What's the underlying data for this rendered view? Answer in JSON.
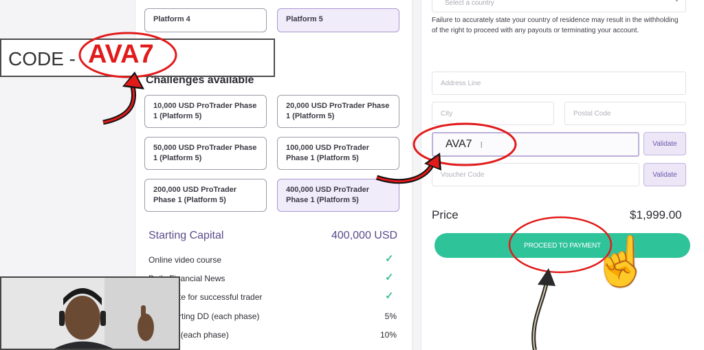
{
  "platforms": {
    "p4": "Platform 4",
    "p5": "Platform 5"
  },
  "promo": {
    "label": "CODE - ",
    "code": "AVA7"
  },
  "challenges": {
    "heading": "Challenges available",
    "items": [
      "10,000 USD ProTrader Phase 1 (Platform 5)",
      "20,000 USD ProTrader Phase 1 (Platform 5)",
      "50,000 USD ProTrader Phase 1 (Platform 5)",
      "100,000 USD ProTrader Phase 1 (Platform 5)",
      "200,000 USD ProTrader Phase 1 (Platform 5)",
      "400,000 USD ProTrader Phase 1 (Platform 5)"
    ]
  },
  "capital": {
    "label": "Starting Capital",
    "value": "400,000 USD"
  },
  "features": [
    {
      "label": "Online video course",
      "value": ""
    },
    {
      "label": "Daily Financial News",
      "value": ""
    },
    {
      "label": "Certificate for successful trader",
      "value": ""
    },
    {
      "label": "Max Starting DD (each phase)",
      "value": "5%"
    },
    {
      "label": "Max DD (each phase)",
      "value": "10%"
    }
  ],
  "form": {
    "country_placeholder": "Select a country",
    "warning": "Failure to accurately state your country of residence may result in the withholding of the right to proceed with any payouts or terminating your account.",
    "address_placeholder": "Address Line",
    "city_placeholder": "City",
    "postal_placeholder": "Postal Code",
    "code_value": "AVA7",
    "voucher_placeholder": "Voucher Code",
    "validate_label": "Validate"
  },
  "checkout": {
    "price_label": "Price",
    "price_value": "$1,999.00",
    "pay_label": "PROCEED TO PAYMENT"
  },
  "colors": {
    "accent": "#2fc39a",
    "highlight": "#e21a1a",
    "selected": "#f1ecfa"
  }
}
